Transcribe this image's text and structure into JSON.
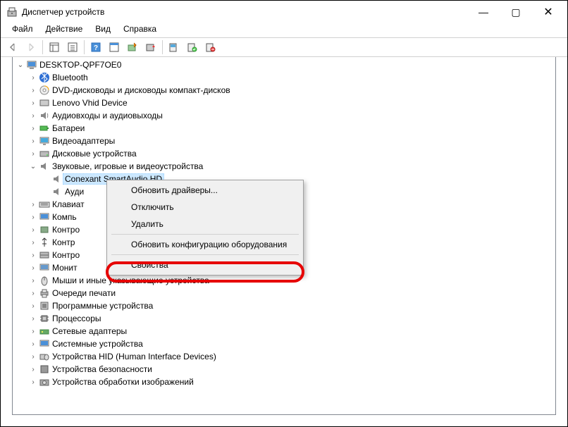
{
  "window": {
    "title": "Диспетчер устройств",
    "min": "—",
    "max": "▢",
    "close": "✕"
  },
  "menu": {
    "file": "Файл",
    "action": "Действие",
    "view": "Вид",
    "help": "Справка"
  },
  "tree": {
    "root": "DESKTOP-QPF7OE0",
    "bluetooth": "Bluetooth",
    "dvd": "DVD-дисководы и дисководы компакт-дисков",
    "lenovo": "Lenovo Vhid Device",
    "audio_io": "Аудиовходы и аудиовыходы",
    "battery": "Батареи",
    "video": "Видеоадаптеры",
    "disk": "Дисковые устройства",
    "sound": "Звуковые, игровые и видеоустройства",
    "conexant": "Conexant SmartAudio HD",
    "audio_partial": "Ауди",
    "keyboard": "Клавиат",
    "computer": "Компь",
    "ctrl1": "Контро",
    "ctrl2": "Контр",
    "ctrl3": "Контро",
    "monitor": "Монит",
    "mouse": "Мыши и иные указывающие устройства",
    "print": "Очереди печати",
    "software": "Программные устройства",
    "cpu": "Процессоры",
    "net": "Сетевые адаптеры",
    "system": "Системные устройства",
    "hid": "Устройства HID (Human Interface Devices)",
    "security": "Устройства безопасности",
    "imaging": "Устройства обработки изображений"
  },
  "context": {
    "update": "Обновить драйверы...",
    "disable": "Отключить",
    "delete": "Удалить",
    "scan": "Обновить конфигурацию оборудования",
    "props": "Свойства"
  }
}
